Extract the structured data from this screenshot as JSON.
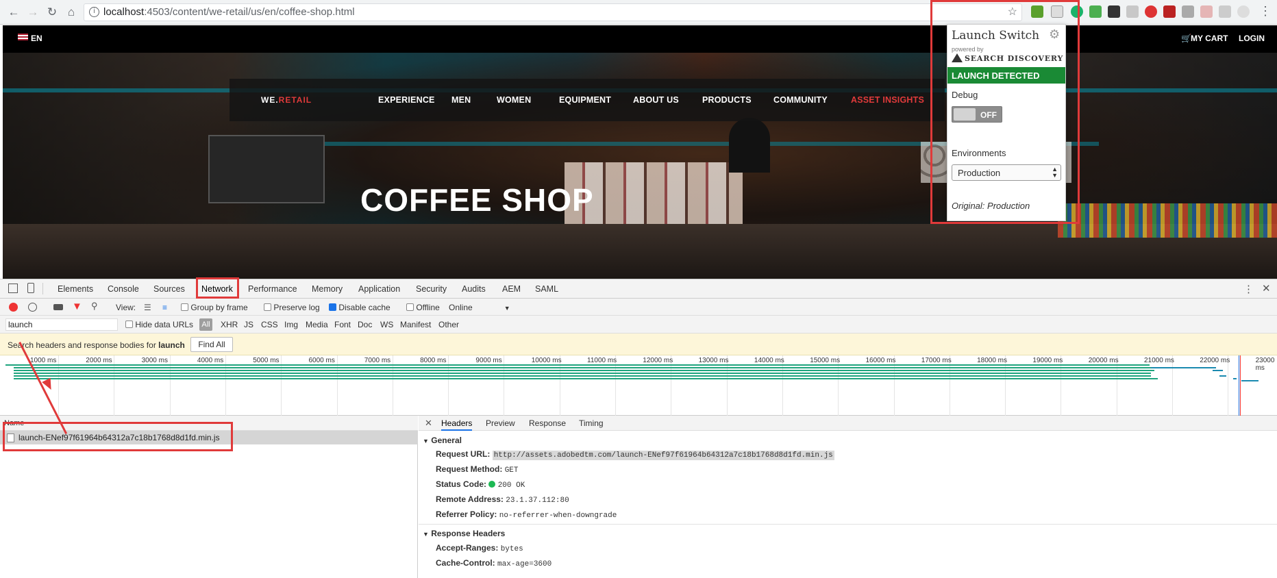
{
  "browser": {
    "url_host": "localhost",
    "url_rest": ":4503/content/we-retail/us/en/coffee-shop.html",
    "icons": [
      "back-icon",
      "forward-icon",
      "reload-icon",
      "home-icon",
      "info-icon",
      "star-icon"
    ]
  },
  "site": {
    "language": "EN",
    "cart": "MY CART",
    "login": "LOGIN",
    "logo_left": "WE.",
    "logo_right": "RETAIL",
    "nav": [
      "EXPERIENCE",
      "MEN",
      "WOMEN",
      "EQUIPMENT",
      "ABOUT US",
      "PRODUCTS",
      "COMMUNITY",
      "ASSET INSIGHTS"
    ],
    "title": "COFFEE SHOP"
  },
  "popup": {
    "title": "Launch Switch",
    "powered_by": "powered by",
    "brand": "SEARCH DISCOVERY",
    "detected": "LAUNCH DETECTED",
    "debug_label": "Debug",
    "debug_toggle": "OFF",
    "env_label": "Environments",
    "env_value": "Production",
    "original": "Original: Production",
    "colors": {
      "detected_bg": "#1a8a35"
    }
  },
  "devtools": {
    "tabs": [
      "Elements",
      "Console",
      "Sources",
      "Network",
      "Performance",
      "Memory",
      "Application",
      "Security",
      "Audits",
      "AEM",
      "SAML"
    ],
    "active_tab": "Network",
    "toolbar": {
      "view": "View:",
      "group_by_frame": "Group by frame",
      "preserve_log": "Preserve log",
      "disable_cache": "Disable cache",
      "offline": "Offline",
      "throttle": "Online"
    },
    "filter": {
      "value": "launch",
      "hide_data_urls": "Hide data URLs",
      "types": [
        "All",
        "XHR",
        "JS",
        "CSS",
        "Img",
        "Media",
        "Font",
        "Doc",
        "WS",
        "Manifest",
        "Other"
      ]
    },
    "search_bar": {
      "prefix": "Search headers and response bodies for",
      "term": "launch",
      "button": "Find All"
    },
    "timeline_ticks": [
      "1000 ms",
      "2000 ms",
      "3000 ms",
      "4000 ms",
      "5000 ms",
      "6000 ms",
      "7000 ms",
      "8000 ms",
      "9000 ms",
      "10000 ms",
      "11000 ms",
      "12000 ms",
      "13000 ms",
      "14000 ms",
      "15000 ms",
      "16000 ms",
      "17000 ms",
      "18000 ms",
      "19000 ms",
      "20000 ms",
      "21000 ms",
      "22000 ms",
      "23000 ms"
    ],
    "requests": {
      "column": "Name",
      "items": [
        "launch-ENef97f61964b64312a7c18b1768d8d1fd.min.js"
      ]
    },
    "detail": {
      "tabs": [
        "Headers",
        "Preview",
        "Response",
        "Timing"
      ],
      "active": "Headers",
      "general_title": "General",
      "general": [
        {
          "k": "Request URL:",
          "v": "http://assets.adobedtm.com/launch-ENef97f61964b64312a7c18b1768d8d1fd.min.js"
        },
        {
          "k": "Request Method:",
          "v": "GET"
        },
        {
          "k": "Status Code:",
          "v": "200 OK"
        },
        {
          "k": "Remote Address:",
          "v": "23.1.37.112:80"
        },
        {
          "k": "Referrer Policy:",
          "v": "no-referrer-when-downgrade"
        }
      ],
      "response_title": "Response Headers",
      "response": [
        {
          "k": "Accept-Ranges:",
          "v": "bytes"
        },
        {
          "k": "Cache-Control:",
          "v": "max-age=3600"
        }
      ]
    }
  }
}
